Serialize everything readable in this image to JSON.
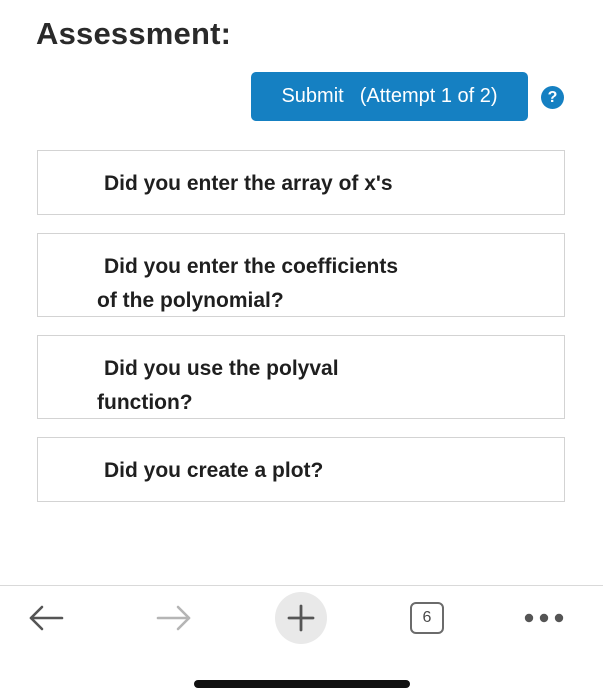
{
  "header": {
    "title": "Assessment:"
  },
  "submit": {
    "label": "Submit",
    "attempt": "(Attempt 1 of 2)"
  },
  "help": {
    "glyph": "?",
    "icon": "question-circle-icon"
  },
  "questions": [
    {
      "line1": "Did you enter the array of x's"
    },
    {
      "line1": "Did you enter the coefficients",
      "line2": "of the polynomial?"
    },
    {
      "line1": "Did you use the polyval",
      "line2": "function?"
    },
    {
      "line1": "Did you create a plot?"
    }
  ],
  "browser_toolbar": {
    "back_icon": "back-arrow-icon",
    "forward_icon": "forward-arrow-icon",
    "new_tab_icon": "plus-icon",
    "tab_count": "6",
    "more_icon": "more-dots-icon"
  },
  "colors": {
    "accent": "#1580c2",
    "border": "#d3d3d3",
    "text": "#1f1f1f"
  }
}
